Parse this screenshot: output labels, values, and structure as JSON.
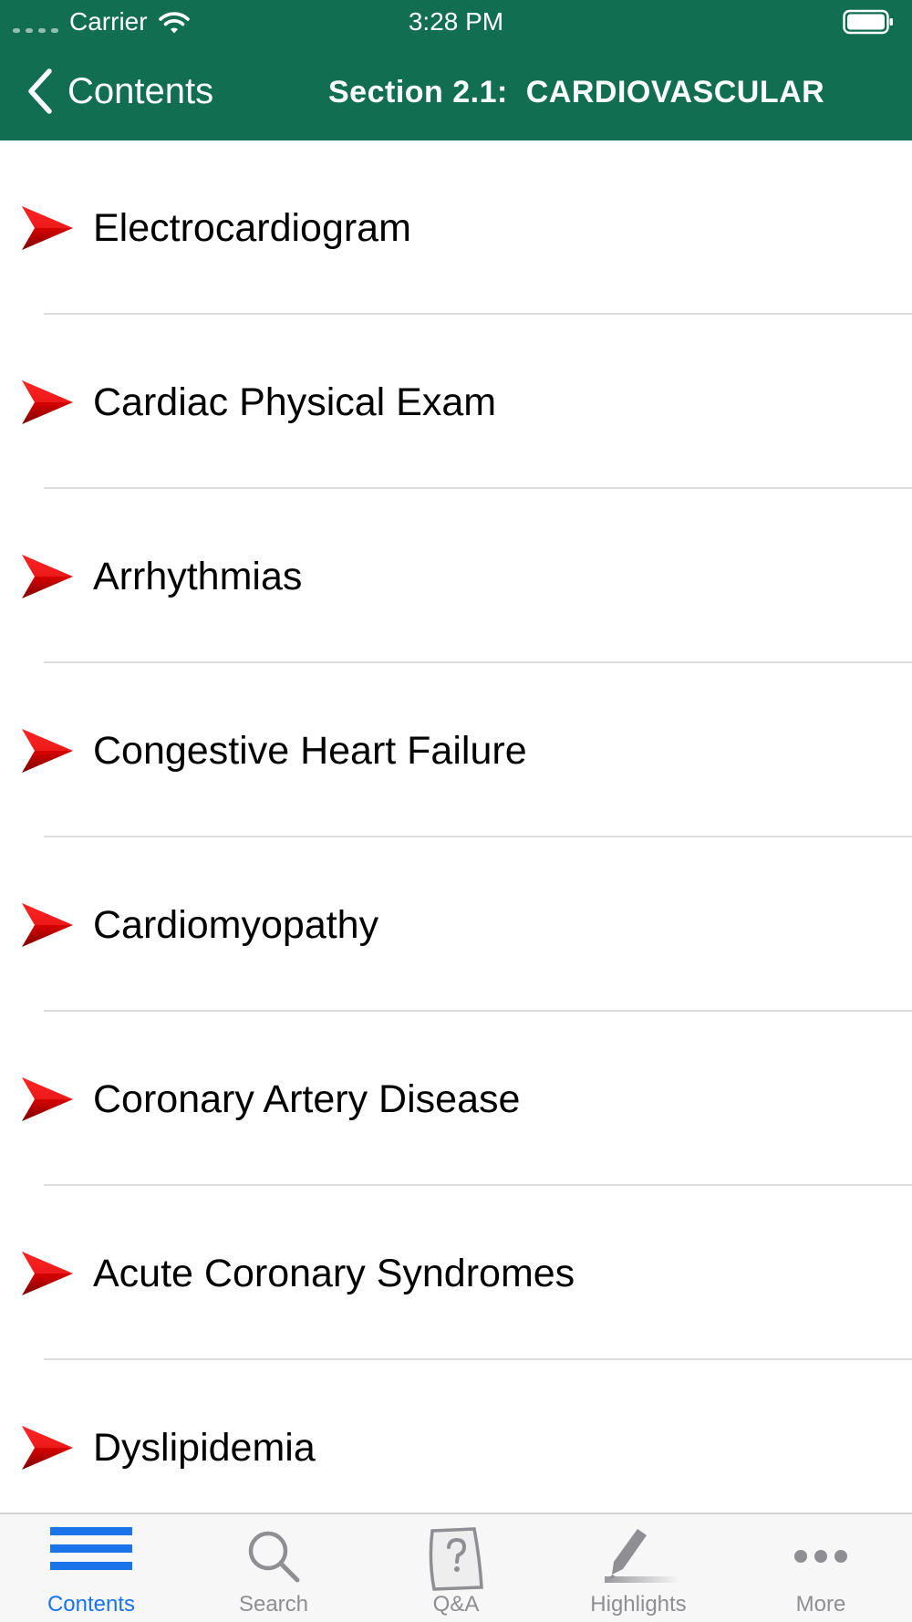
{
  "status_bar": {
    "carrier": "Carrier",
    "time": "3:28 PM"
  },
  "nav": {
    "back_label": "Contents",
    "title": "Section 2.1:  CARDIOVASCULAR"
  },
  "list": {
    "items": [
      {
        "label": "Electrocardiogram"
      },
      {
        "label": "Cardiac Physical Exam"
      },
      {
        "label": "Arrhythmias"
      },
      {
        "label": "Congestive Heart Failure"
      },
      {
        "label": "Cardiomyopathy"
      },
      {
        "label": "Coronary Artery Disease"
      },
      {
        "label": "Acute Coronary Syndromes"
      },
      {
        "label": "Dyslipidemia"
      }
    ]
  },
  "tab_bar": {
    "tabs": [
      {
        "label": "Contents",
        "icon": "list-icon",
        "active": true
      },
      {
        "label": "Search",
        "icon": "search-icon",
        "active": false
      },
      {
        "label": "Q&A",
        "icon": "question-doc-icon",
        "active": false
      },
      {
        "label": "Highlights",
        "icon": "highlighter-icon",
        "active": false
      },
      {
        "label": "More",
        "icon": "more-dots-icon",
        "active": false
      }
    ]
  },
  "colors": {
    "header_green": "#116e50",
    "arrow_red": "#d40000",
    "tab_active_blue": "#1a73e8",
    "tab_inactive_gray": "#8e8e93"
  }
}
